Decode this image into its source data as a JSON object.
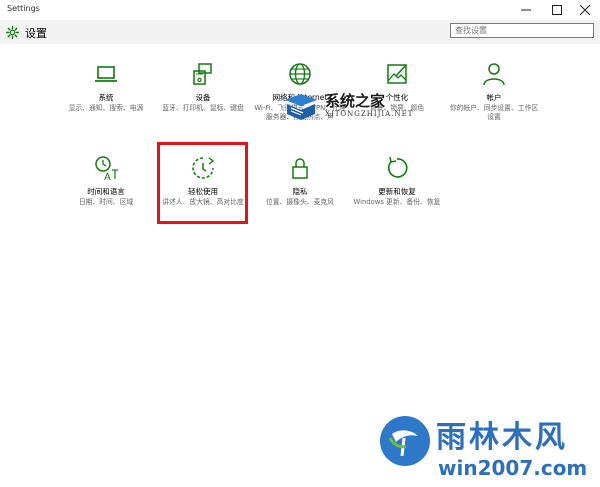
{
  "window": {
    "title": "Settings"
  },
  "header": {
    "title": "设置"
  },
  "search": {
    "placeholder": "查找设置"
  },
  "accent_color": "#107c10",
  "tiles": [
    {
      "title": "系统",
      "desc": "显示、通知、搜索、电源",
      "icon": "laptop-icon"
    },
    {
      "title": "设备",
      "desc": "蓝牙、打印机、鼠标、键盘",
      "icon": "devices-icon"
    },
    {
      "title": "网络和 Internet",
      "desc": "Wi-Fi、飞行模式、VPN、代理服务器、移动热点、声",
      "icon": "globe-icon"
    },
    {
      "title": "个性化",
      "desc": "背景、锁屏、颜色",
      "icon": "personalization-icon"
    },
    {
      "title": "帐户",
      "desc": "你的帐户、同步设置、工作区设置",
      "icon": "person-icon"
    },
    {
      "title": "时间和语言",
      "desc": "日期、时间、区域",
      "icon": "time-language-icon"
    },
    {
      "title": "轻松使用",
      "desc": "讲述人、放大镜、高对比度",
      "icon": "ease-of-access-icon"
    },
    {
      "title": "隐私",
      "desc": "位置、摄像头、麦克风",
      "icon": "lock-icon"
    },
    {
      "title": "更新和恢复",
      "desc": "Windows 更新、备份、恢复",
      "icon": "update-icon"
    }
  ],
  "watermark": {
    "cn": "系统之家",
    "en": "XITONGZHIJIA.NET"
  },
  "brand": {
    "cn": "雨林木风",
    "en": "win2007.com"
  }
}
